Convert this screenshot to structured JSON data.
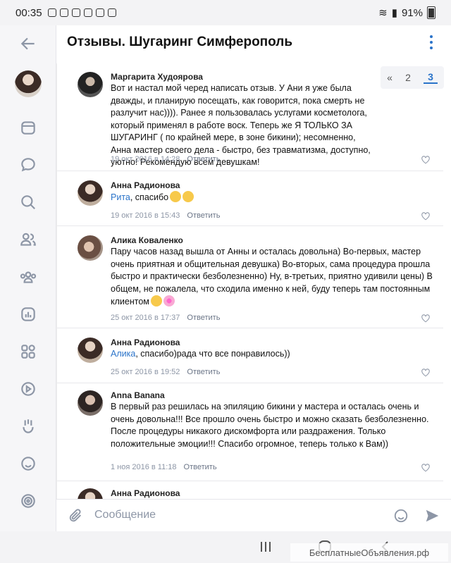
{
  "status": {
    "time": "00:35",
    "battery": "91%"
  },
  "header": {
    "title": "Отзывы. Шугаринг Симферополь"
  },
  "pager": {
    "prev": "«",
    "page2": "2",
    "page3": "3"
  },
  "comments": [
    {
      "author": "Маргарита Худоярова",
      "text": "Вот и настал мой черед написать отзыв. У Ани я уже была дважды, и планирую посещать, как говорится, пока смерть не разлучит нас)))). Ранее я пользовалась услугами косметолога, который применял в работе воск. Теперь же Я ТОЛЬКО ЗА ШУГАРИНГ ( по крайней мере, в зоне бикини); несомненно, Анна мастер своего дела - быстро, без травматизма, доступно, уютно! Рекомендую всем девушкам!",
      "date": "19 окт 2016 в 14:28",
      "reply": "Ответить"
    },
    {
      "author": "Анна Радионова",
      "mention": "Рита",
      "text": ", спасибо",
      "date": "19 окт 2016 в 15:43",
      "reply": "Ответить"
    },
    {
      "author": "Алика Коваленко",
      "text": "Пару часов назад вышла от Анны и осталась довольна) Во-первых, мастер очень приятная и общительная девушка) Во-вторых, сама процедура прошла быстро и практически безболезненно) Ну, в-третьих, приятно удивили цены) В общем, не пожалела, что сходила именно к ней, буду теперь там постоянным клиентом",
      "date": "25 окт 2016 в 17:37",
      "reply": "Ответить"
    },
    {
      "author": "Анна Радионова",
      "mention": "Алика",
      "text": ", спасибо)рада что все понравилось))",
      "date": "25 окт 2016 в 19:52",
      "reply": "Ответить"
    },
    {
      "author": "Anna Banana",
      "text": "В первый раз решилась на эпиляцию бикини у мастера и осталась очень и очень довольна!!! Все прошло очень быстро и можно сказать безболезненно. После процедуры никакого дискомфорта или раздражения. Только положительные эмоции!!! Спасибо огромное, теперь только к Вам))",
      "date": "1 ноя 2016 в 11:18",
      "reply": "Ответить"
    },
    {
      "author": "Анна Радионова"
    }
  ],
  "composer": {
    "placeholder": "Сообщение"
  },
  "watermark": "БесплатныеОбъявления.рф",
  "colors": {
    "accent": "#2a73c9",
    "muted": "#8d96a6"
  },
  "icons": {
    "sidebar": [
      "back-icon",
      "calendar-icon",
      "chat-icon",
      "search-icon",
      "friends-icon",
      "groups-icon",
      "stats-icon",
      "apps-icon",
      "video-icon",
      "clips-icon",
      "emoji-icon",
      "target-icon"
    ]
  }
}
